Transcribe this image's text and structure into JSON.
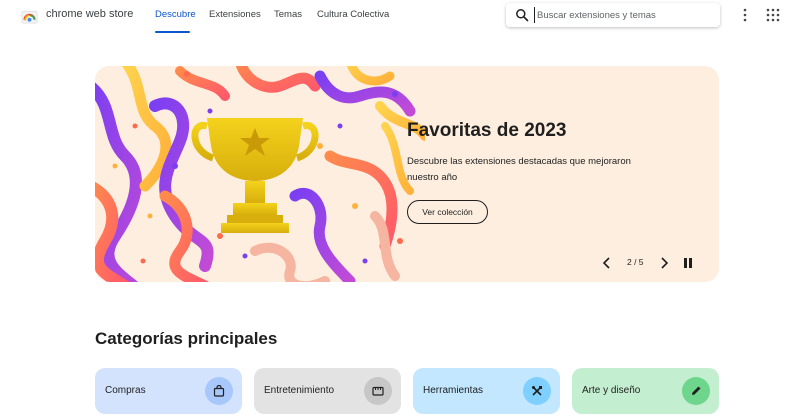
{
  "header": {
    "brand": "chrome web store",
    "nav": [
      "Descubre",
      "Extensiones",
      "Temas",
      "Cultura Colectiva"
    ],
    "active_nav": "Descubre",
    "search_placeholder": "Buscar extensiones y temas"
  },
  "banner": {
    "title": "Favoritas de 2023",
    "description": "Descubre las extensiones destacadas que mejoraron nuestro año",
    "button_label": "Ver colección",
    "pager": "2 / 5"
  },
  "categories": {
    "title": "Categorías principales",
    "items": [
      {
        "label": "Compras",
        "icon": "shopping-bag-icon",
        "bg": "#d3e3fd",
        "icon_bg": "#a8c7fa"
      },
      {
        "label": "Entretenimiento",
        "icon": "ticket-icon",
        "bg": "#e3e3e3",
        "icon_bg": "#c7c7c7"
      },
      {
        "label": "Herramientas",
        "icon": "tools-icon",
        "bg": "#c2e7ff",
        "icon_bg": "#7fcfff"
      },
      {
        "label": "Arte y diseño",
        "icon": "pencil-icon",
        "bg": "#c4eed0",
        "icon_bg": "#6dd58c"
      }
    ]
  },
  "colors": {
    "accent": "#0b57d0",
    "banner_bg": "#fdeedf",
    "trophy": "#e8c21a"
  }
}
